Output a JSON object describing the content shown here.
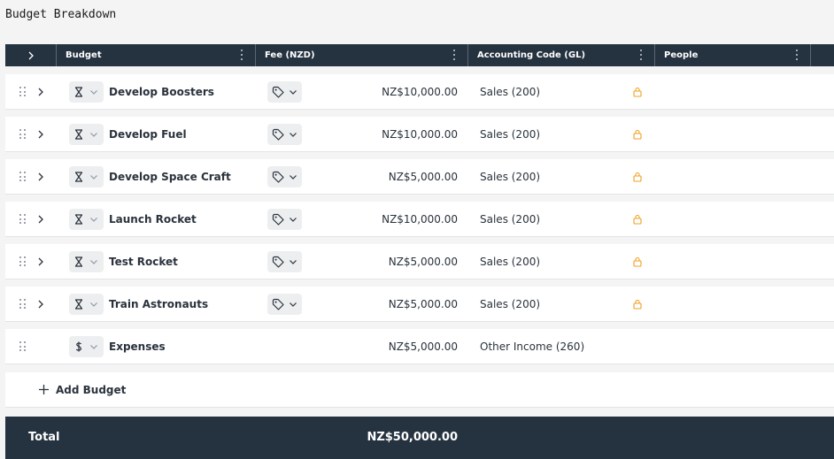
{
  "page": {
    "title": "Budget Breakdown"
  },
  "header": {
    "budget": "Budget",
    "fee": "Fee (NZD)",
    "accounting_code": "Accounting Code (GL)",
    "people": "People"
  },
  "rows": [
    {
      "name": "Develop Boosters",
      "type_icon": "hourglass-icon",
      "fee": "NZ$10,000.00",
      "account": "Sales (200)",
      "locked": true,
      "expandable": true
    },
    {
      "name": "Develop Fuel",
      "type_icon": "hourglass-icon",
      "fee": "NZ$10,000.00",
      "account": "Sales (200)",
      "locked": true,
      "expandable": true
    },
    {
      "name": "Develop Space Craft",
      "type_icon": "hourglass-icon",
      "fee": "NZ$5,000.00",
      "account": "Sales (200)",
      "locked": true,
      "expandable": true
    },
    {
      "name": "Launch Rocket",
      "type_icon": "hourglass-icon",
      "fee": "NZ$10,000.00",
      "account": "Sales (200)",
      "locked": true,
      "expandable": true
    },
    {
      "name": "Test Rocket",
      "type_icon": "hourglass-icon",
      "fee": "NZ$5,000.00",
      "account": "Sales (200)",
      "locked": true,
      "expandable": true
    },
    {
      "name": "Train Astronauts",
      "type_icon": "hourglass-icon",
      "fee": "NZ$5,000.00",
      "account": "Sales (200)",
      "locked": true,
      "expandable": true
    },
    {
      "name": "Expenses",
      "type_icon": "dollar-icon",
      "fee": "NZ$5,000.00",
      "account": "Other Income (260)",
      "locked": false,
      "expandable": false
    }
  ],
  "add_budget": {
    "label": "Add Budget"
  },
  "footer": {
    "label": "Total",
    "total": "NZ$50,000.00"
  },
  "colors": {
    "header_bg": "#253240",
    "lock": "#f0a020",
    "row_bg": "#ffffff",
    "page_bg": "#f4f4f4"
  }
}
